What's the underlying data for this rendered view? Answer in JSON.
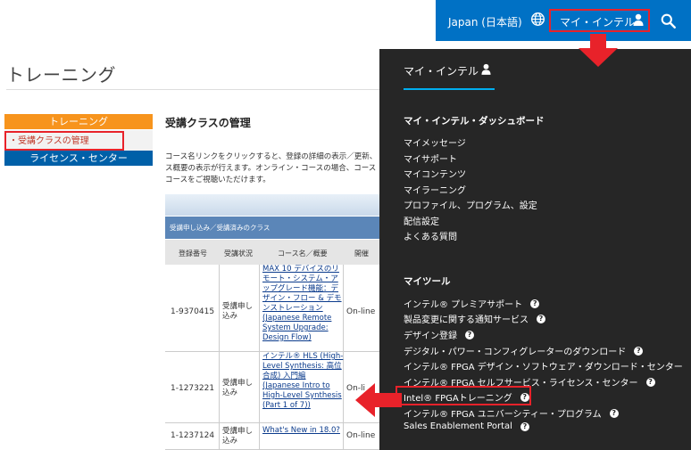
{
  "topbar": {
    "region": "Japan (日本語)",
    "my_intel": "マイ・インテル"
  },
  "page": {
    "title": "トレーニング"
  },
  "sidenav": {
    "head": "トレーニング",
    "item": "・受講クラスの管理",
    "license": "ライセンス・センター"
  },
  "main": {
    "section_title": "受講クラスの管理",
    "desc_lines": [
      "コース名リンクをクリックすると、登録の詳細の表示／更新、",
      "ス概要の表示が行えます。オンライン・コースの場合、コース",
      "コースをご視聴いただけます。"
    ],
    "table": {
      "caption": "受講申し込み／受講済みのクラス",
      "headers": [
        "登録番号",
        "受講状況",
        "コース名／概要",
        "開催"
      ],
      "rows": [
        {
          "id": "1-9370415",
          "status": "受講申し込み",
          "course": "MAX 10 デバイスのリモート・システム・アップグレード機能：デザイン・フロー & デモンストレーション (Japanese Remote System Upgrade: Design Flow)",
          "delivery": "On-line"
        },
        {
          "id": "1-1273221",
          "status": "受講申し込み",
          "course": "インテル® HLS (High-Level Synthesis: 高位合成) 入門編 (Japanese Intro to High-Level Synthesis (Part 1 of 7))",
          "delivery": "On-li"
        },
        {
          "id": "1-1237124",
          "status": "受講申し込み",
          "course": "What's New in 18.0?",
          "delivery": "On-line"
        }
      ]
    }
  },
  "menu": {
    "title": "マイ・インテル",
    "dashboard_title": "マイ・インテル・ダッシュボード",
    "dashboard_items": [
      "マイメッセージ",
      "マイサポート",
      "マイコンテンツ",
      "マイラーニング",
      "プロファイル、プログラム、設定",
      "配信設定",
      "よくある質問"
    ],
    "tools_title": "マイツール",
    "tools_items": [
      "インテル® プレミアサポート",
      "製品変更に関する通知サービス",
      "デザイン登録",
      "デジタル・パワー・コンフィグレーターのダウンロード",
      "インテル® FPGA デザイン・ソフトウェア・ダウンロード・センター",
      "インテル® FPGA セルフサービス・ライセンス・センター",
      "Intel® FPGAトレーニング",
      "インテル® FPGA ユニバーシティー・プログラム",
      "Sales Enablement Portal"
    ],
    "help_glyph": "?"
  },
  "colors": {
    "brand_blue": "#0071c5",
    "menu_bg": "#262626",
    "highlight_red": "#e8222a",
    "nav_orange": "#f7941d",
    "accent_cyan": "#00aeef"
  },
  "icons": [
    "globe-icon",
    "user-icon",
    "search-icon",
    "help-icon",
    "arrow-down-icon",
    "arrow-left-icon"
  ]
}
